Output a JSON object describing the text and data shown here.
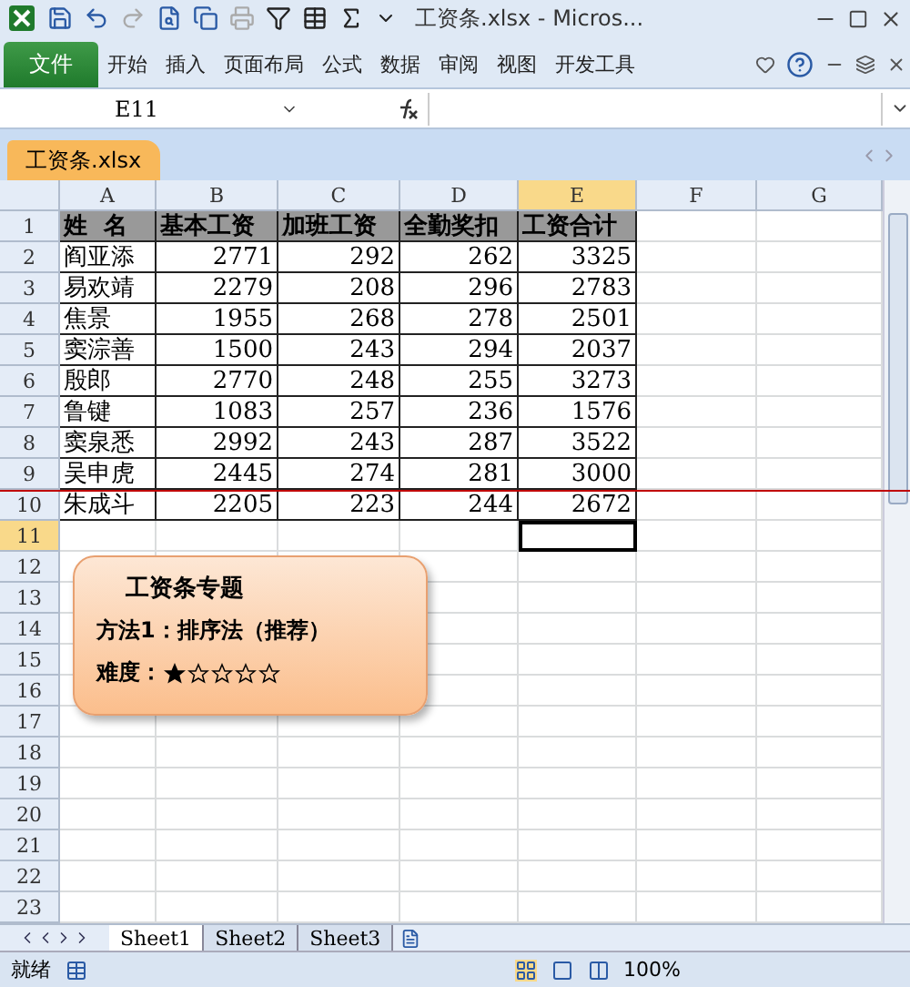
{
  "window": {
    "title": "工资条.xlsx - Micros..."
  },
  "ribbon": {
    "file_tab": "文件",
    "tabs": [
      {
        "label": "开始",
        "selected": false
      },
      {
        "label": "插入",
        "selected": false
      },
      {
        "label": "页面布局",
        "selected": false
      },
      {
        "label": "公式",
        "selected": false
      },
      {
        "label": "数据",
        "selected": false
      },
      {
        "label": "审阅",
        "selected": false
      },
      {
        "label": "视图",
        "selected": false
      },
      {
        "label": "开发工具",
        "selected": false
      }
    ]
  },
  "formula_bar": {
    "name_box": "E11"
  },
  "workbook_tab": "工资条.xlsx",
  "sheet": {
    "columns": [
      {
        "label": "A",
        "selected": false
      },
      {
        "label": "B",
        "selected": false
      },
      {
        "label": "C",
        "selected": false
      },
      {
        "label": "D",
        "selected": false
      },
      {
        "label": "E",
        "selected": true
      },
      {
        "label": "F",
        "selected": false
      },
      {
        "label": "G",
        "selected": false
      }
    ],
    "rows": [
      {
        "number": "1",
        "selected": false,
        "kind": "header",
        "cells": [
          "姓  名",
          "基本工资",
          "加班工资",
          "全勤奖扣",
          "工资合计"
        ]
      },
      {
        "number": "2",
        "selected": false,
        "kind": "data",
        "cells": [
          "阎亚添",
          "2771",
          "292",
          "262",
          "3325"
        ]
      },
      {
        "number": "3",
        "selected": false,
        "kind": "data",
        "cells": [
          "易欢靖",
          "2279",
          "208",
          "296",
          "2783"
        ]
      },
      {
        "number": "4",
        "selected": false,
        "kind": "data",
        "cells": [
          "焦景",
          "1955",
          "268",
          "278",
          "2501"
        ]
      },
      {
        "number": "5",
        "selected": false,
        "kind": "data",
        "cells": [
          "窦淙善",
          "1500",
          "243",
          "294",
          "2037"
        ]
      },
      {
        "number": "6",
        "selected": false,
        "kind": "data",
        "cells": [
          "殷郎",
          "2770",
          "248",
          "255",
          "3273"
        ]
      },
      {
        "number": "7",
        "selected": false,
        "kind": "data",
        "cells": [
          "鲁键",
          "1083",
          "257",
          "236",
          "1576"
        ]
      },
      {
        "number": "8",
        "selected": false,
        "kind": "data",
        "cells": [
          "窦泉悉",
          "2992",
          "243",
          "287",
          "3522"
        ]
      },
      {
        "number": "9",
        "selected": false,
        "kind": "data",
        "cells": [
          "吴申虎",
          "2445",
          "274",
          "281",
          "3000"
        ]
      },
      {
        "number": "10",
        "selected": false,
        "kind": "data",
        "cells": [
          "朱成斗",
          "2205",
          "223",
          "244",
          "2672"
        ]
      },
      {
        "number": "11",
        "selected": true,
        "kind": "empty"
      },
      {
        "number": "12",
        "selected": false,
        "kind": "empty"
      },
      {
        "number": "13",
        "selected": false,
        "kind": "empty"
      },
      {
        "number": "14",
        "selected": false,
        "kind": "empty"
      },
      {
        "number": "15",
        "selected": false,
        "kind": "empty"
      },
      {
        "number": "16",
        "selected": false,
        "kind": "empty"
      },
      {
        "number": "17",
        "selected": false,
        "kind": "empty"
      },
      {
        "number": "18",
        "selected": false,
        "kind": "empty"
      },
      {
        "number": "19",
        "selected": false,
        "kind": "empty"
      },
      {
        "number": "20",
        "selected": false,
        "kind": "empty"
      },
      {
        "number": "21",
        "selected": false,
        "kind": "empty"
      },
      {
        "number": "22",
        "selected": false,
        "kind": "empty"
      },
      {
        "number": "23",
        "selected": false,
        "kind": "empty"
      }
    ]
  },
  "callout": {
    "title": "工资条专题",
    "method": "方法1：排序法（推荐）",
    "difficulty_label": "难度：",
    "stars": 1
  },
  "sheet_tabs": [
    {
      "label": "Sheet1",
      "selected": true
    },
    {
      "label": "Sheet2",
      "selected": false
    },
    {
      "label": "Sheet3",
      "selected": false
    }
  ],
  "status_bar": {
    "status": "就绪",
    "zoom": "100%"
  }
}
